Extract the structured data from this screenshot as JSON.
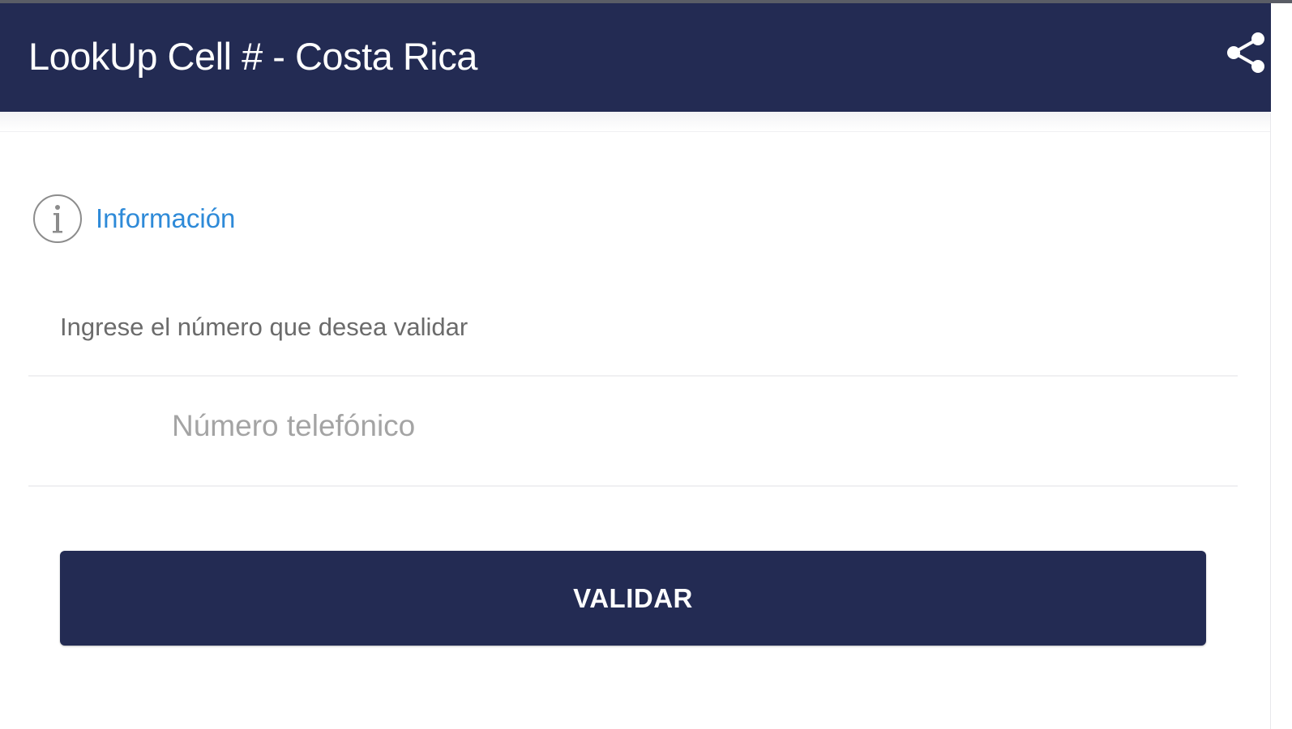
{
  "header": {
    "title": "LookUp Cell # - Costa Rica",
    "share_icon": "share-icon",
    "background_color": "#232b53"
  },
  "info": {
    "label": "Información",
    "icon": "info-circle-icon",
    "color": "#2e8ad8"
  },
  "form": {
    "prompt": "Ingrese el número que desea validar",
    "phone_placeholder": "Número telefónico",
    "phone_value": "",
    "submit_label": "VALIDAR"
  }
}
